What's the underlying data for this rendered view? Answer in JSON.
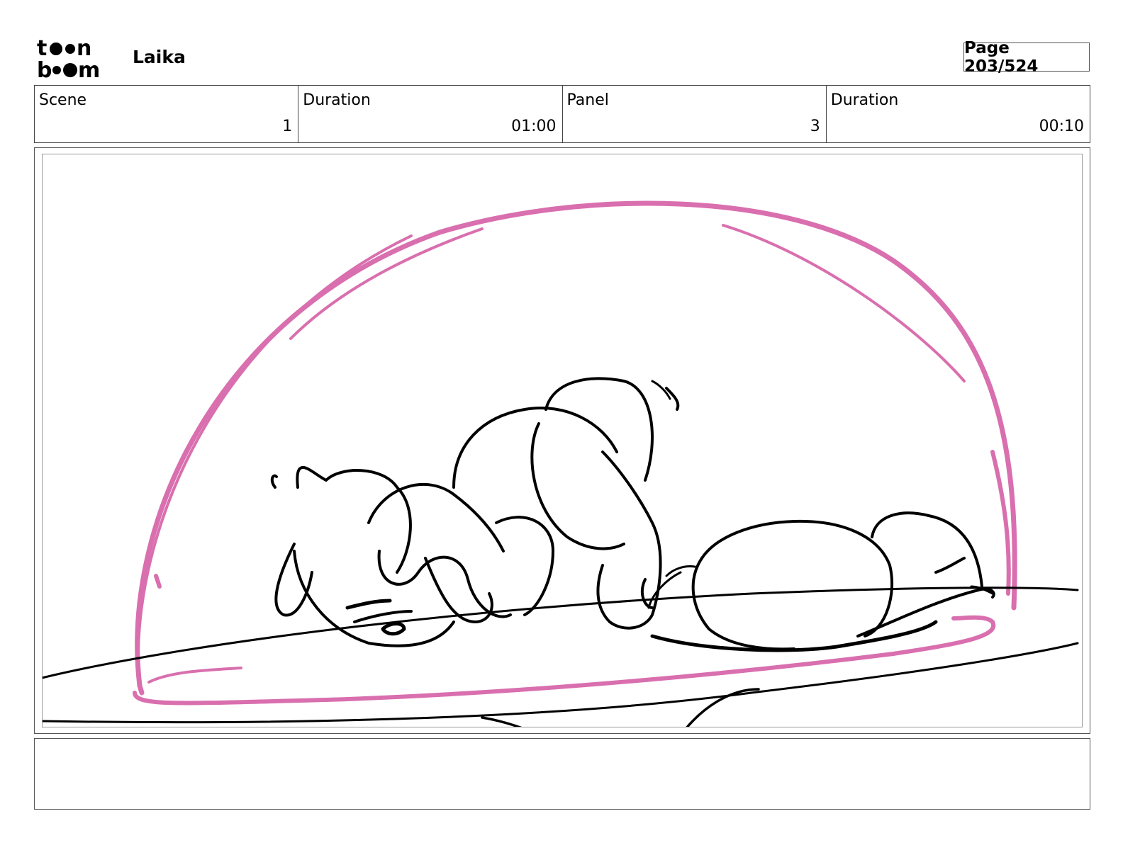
{
  "header": {
    "logo_top": "t●●n",
    "logo_bottom": "b●●m",
    "project_title": "Laika",
    "page_label": "Page 203/524"
  },
  "info": {
    "scene_label": "Scene",
    "scene_value": "1",
    "scene_duration_label": "Duration",
    "scene_duration_value": "01:00",
    "panel_label": "Panel",
    "panel_value": "3",
    "panel_duration_label": "Duration",
    "panel_duration_value": "00:10"
  },
  "colors": {
    "sketch_pink": "#d96fae",
    "sketch_black": "#000000",
    "border": "#444444"
  },
  "notes": {
    "text": ""
  }
}
